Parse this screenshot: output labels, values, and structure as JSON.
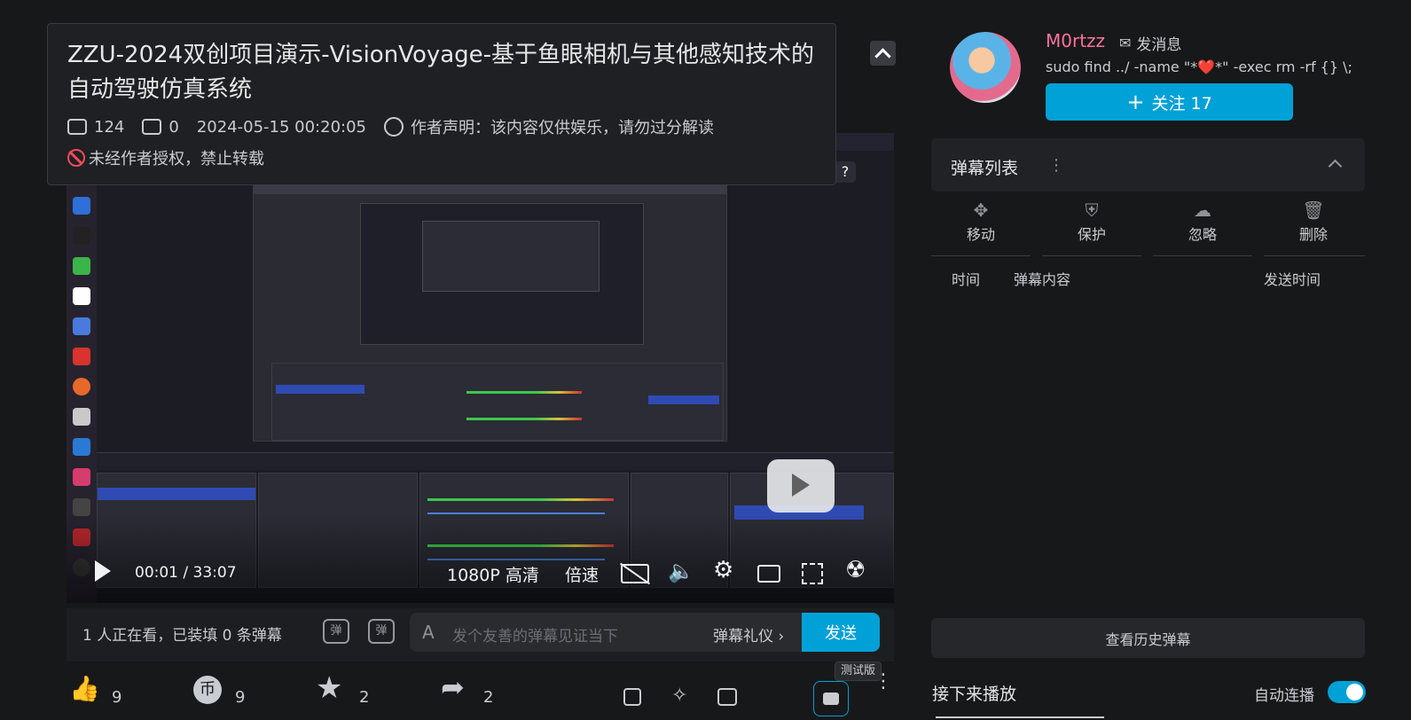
{
  "video": {
    "title": "ZZU-2024双创项目演示-VisionVoyage-基于鱼眼相机与其他感知技术的自动驾驶仿真系统",
    "plays": "124",
    "danmaku_count": "0",
    "publish_time": "2024-05-15 00:20:05",
    "author_statement": "作者声明：该内容仅供娱乐，请勿过分解读",
    "copyright": "未经作者授权，禁止转载"
  },
  "player": {
    "current_time": "00:01",
    "separator": "/",
    "duration": "33:07",
    "quality": "1080P 高清",
    "speed": "倍速",
    "progress_fraction": 0.0005
  },
  "danmaku_bar": {
    "viewers": "1 人正在看，已装填 0 条弹幕",
    "placeholder": "发个友善的弹幕见证当下",
    "etiquette": "弹幕礼仪",
    "send": "发送"
  },
  "actions": {
    "like": "9",
    "coin": "9",
    "favorite": "2",
    "share": "2",
    "beta_tag": "测试版"
  },
  "uploader": {
    "name": "M0rtzz",
    "message": "发消息",
    "bio": "sudo find ../ -name \"*❤️*\" -exec rm -rf {} \\;",
    "follow": "关注 17"
  },
  "danmaku_list": {
    "title": "弹幕列表",
    "tools": [
      "移动",
      "保护",
      "忽略",
      "删除"
    ],
    "columns": {
      "time": "时间",
      "content": "弹幕内容",
      "sent": "发送时间"
    },
    "history": "查看历史弹幕"
  },
  "next_up": {
    "title": "接下来播放",
    "autoplay": "自动连播",
    "autoplay_on": true
  },
  "colors": {
    "accent": "#00a1d6",
    "username": "#fb7299"
  }
}
